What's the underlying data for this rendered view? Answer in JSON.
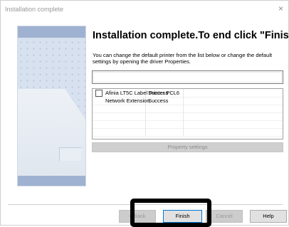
{
  "window": {
    "title": "Installation complete",
    "close_glyph": "×"
  },
  "main": {
    "heading": "Installation complete.To end click \"Finish\".",
    "description": "You can change the default printer from the list below or change the default settings by opening the driver Properties.",
    "combo_value": "",
    "list": {
      "rows": [
        {
          "name": "Afinia LT5C Label Printer PCL6",
          "status": "Success",
          "checked": false
        },
        {
          "name": "Network Extension",
          "status": "Success"
        }
      ]
    },
    "property_button": "Property settings"
  },
  "footer": {
    "back": "< Back",
    "finish": "Finish",
    "cancel": "Cancel",
    "help": "Help"
  },
  "icons": {
    "close": "close-icon",
    "sidebar": "printer-illustration"
  }
}
